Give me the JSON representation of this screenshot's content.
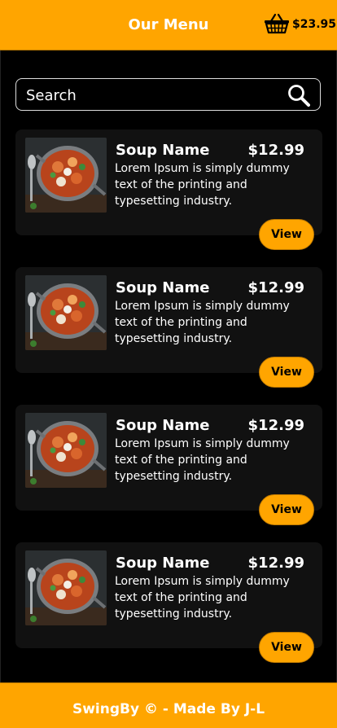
{
  "header": {
    "title": "Our Menu",
    "cart_total": "$23.95",
    "cart_icon": "basket-icon"
  },
  "search": {
    "placeholder": "Search",
    "value": "",
    "icon": "search-icon"
  },
  "menu": {
    "items": [
      {
        "name": "Soup Name",
        "price": "$12.99",
        "description": "Lorem Ipsum is simply dummy text of the printing and typesetting industry.",
        "button_label": "View"
      },
      {
        "name": "Soup Name",
        "price": "$12.99",
        "description": "Lorem Ipsum is simply dummy text of the printing and typesetting industry.",
        "button_label": "View"
      },
      {
        "name": "Soup Name",
        "price": "$12.99",
        "description": "Lorem Ipsum is simply dummy text of the printing and typesetting industry.",
        "button_label": "View"
      },
      {
        "name": "Soup Name",
        "price": "$12.99",
        "description": "Lorem Ipsum is simply dummy text of the printing and typesetting industry.",
        "button_label": "View"
      }
    ]
  },
  "footer": {
    "text": "SwingBy © - Made By J-L"
  },
  "colors": {
    "accent": "#ffa500",
    "background": "#000000",
    "card": "#111111"
  }
}
